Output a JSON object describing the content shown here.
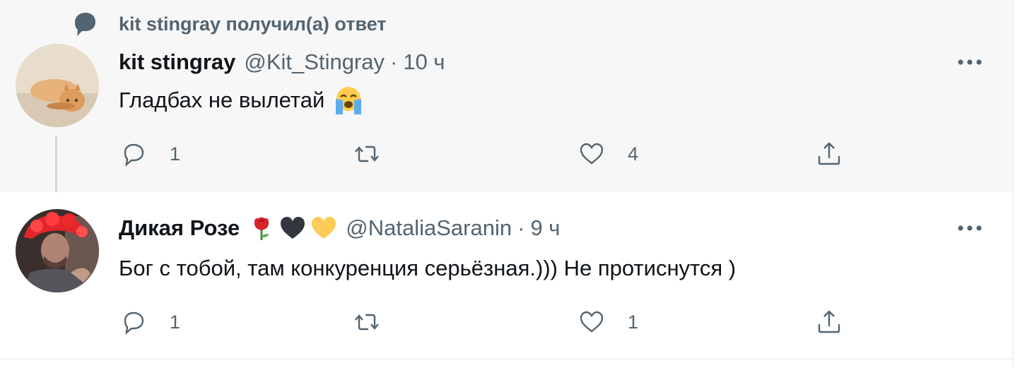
{
  "social_context": {
    "text": "kit stingray получил(а) ответ",
    "icon": "speech-bubble-icon"
  },
  "tweets": [
    {
      "display_name": "kit stingray",
      "handle": "@Kit_Stingray",
      "separator": "·",
      "time": "10 ч",
      "text": "Гладбах не вылетай",
      "text_emoji": "loudly-crying-face-emoji",
      "actions": {
        "reply_count": "1",
        "retweet_count": "",
        "like_count": "4"
      }
    },
    {
      "display_name": "Дикая Розе",
      "name_emojis": [
        "rose-emoji",
        "black-heart-emoji",
        "yellow-heart-emoji"
      ],
      "handle": "@NataliaSaranin",
      "separator": "·",
      "time": "9 ч",
      "text": "Бог с тобой, там конкуренция серьёзная.))) Не протиснутся )",
      "actions": {
        "reply_count": "1",
        "retweet_count": "",
        "like_count": "1"
      }
    }
  ],
  "colors": {
    "secondary_text": "#536471",
    "primary_text": "#0f1419",
    "highlight_bg": "#f7f7f7",
    "thread_line": "#cfd9de"
  }
}
